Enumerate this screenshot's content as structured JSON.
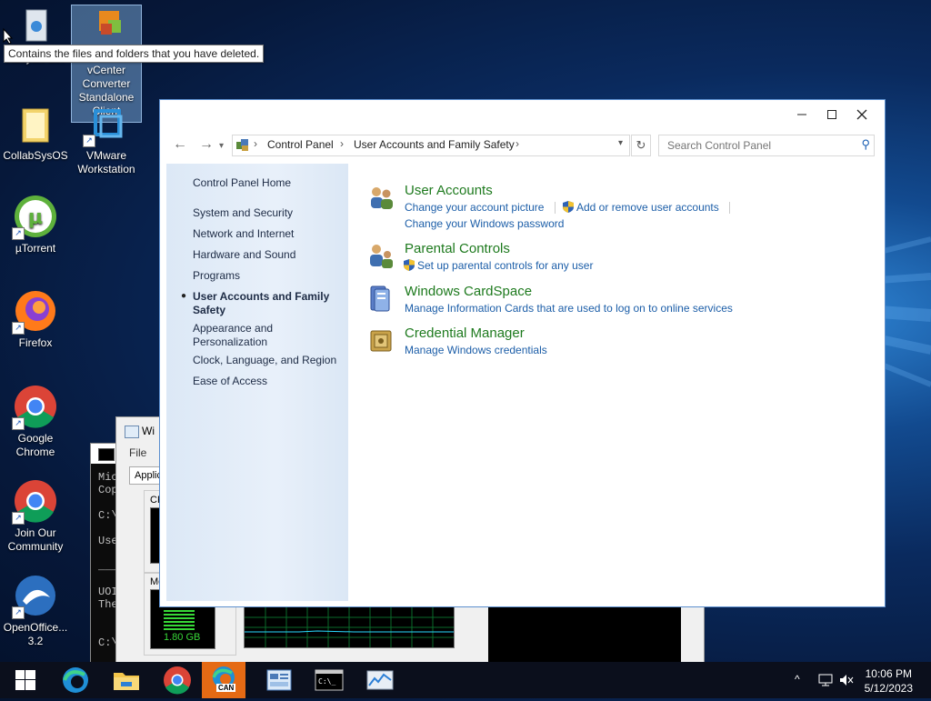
{
  "tooltip": "Contains the files and folders that you have deleted.",
  "desktop": {
    "icons": [
      {
        "label": "Recycle Bin"
      },
      {
        "label": "vCenter Converter Standalone Client"
      },
      {
        "label": "CollabSysOS"
      },
      {
        "label": "VMware Workstation"
      },
      {
        "label": "µTorrent"
      },
      {
        "label": "Firefox"
      },
      {
        "label": "Google Chrome"
      },
      {
        "label": "Join Our Community"
      },
      {
        "label": "OpenOffice... 3.2"
      }
    ]
  },
  "background": {
    "taskmgr_title": "Wi",
    "taskmgr_file": "File",
    "taskmgr_tab": "Applic",
    "cpu_label": "CP",
    "mem_label": "Me",
    "mem_value": "1.80 GB",
    "cmd_lines": [
      "Mic",
      "Cop",
      "",
      "C:\\",
      "",
      "Use",
      "",
      "___",
      "",
      "UOI",
      "The",
      "",
      "",
      "C:\\"
    ]
  },
  "control_panel": {
    "address": {
      "crumbs": [
        "Control Panel",
        "User Accounts and Family Safety"
      ],
      "search_placeholder": "Search Control Panel"
    },
    "left_nav": {
      "home": "Control Panel Home",
      "items": [
        "System and Security",
        "Network and Internet",
        "Hardware and Sound",
        "Programs",
        "User Accounts and Family Safety",
        "Appearance and Personalization",
        "Clock, Language, and Region",
        "Ease of Access"
      ],
      "active_index": 4
    },
    "categories": [
      {
        "title": "User Accounts",
        "links": [
          "Change your account picture",
          "Add or remove user accounts",
          "Change your Windows password"
        ]
      },
      {
        "title": "Parental Controls",
        "links": [
          "Set up parental controls for any user"
        ]
      },
      {
        "title": "Windows CardSpace",
        "links": [
          "Manage Information Cards that are used to log on to online services"
        ]
      },
      {
        "title": "Credential Manager",
        "links": [
          "Manage Windows credentials"
        ]
      }
    ]
  },
  "taskbar": {
    "apps": [
      "start",
      "edge",
      "file-explorer",
      "chrome",
      "edge-can",
      "control-panel",
      "cmd",
      "task-manager"
    ],
    "badge": "CAN",
    "time": "10:06 PM",
    "date": "5/12/2023"
  }
}
